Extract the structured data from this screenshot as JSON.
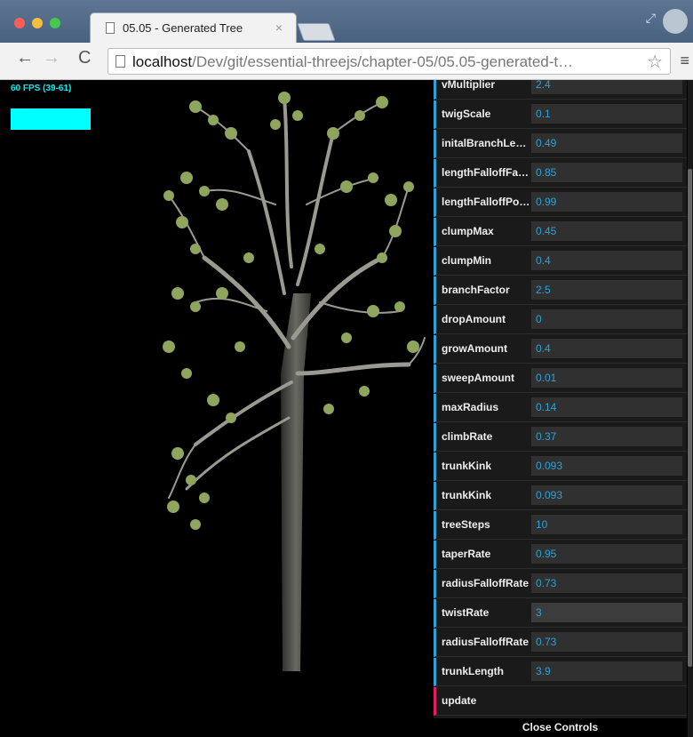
{
  "browser": {
    "tab_title": "05.05 - Generated Tree",
    "tab_close": "×",
    "url_host": "localhost",
    "url_path": "/Dev/git/essential-threejs/chapter-05/05.05-generated-t…",
    "back": "←",
    "forward": "→",
    "reload": "C",
    "star": "☆",
    "menu": "≡",
    "expand": "⤢"
  },
  "stats": {
    "fps_label": "60 FPS (39-61)"
  },
  "colors": {
    "accent": "#2fa1d6",
    "update_accent": "#e61d5f",
    "panel": "#1a1a1a"
  },
  "gui": {
    "rows": [
      {
        "label": "vMultiplier",
        "value": "2.4"
      },
      {
        "label": "twigScale",
        "value": "0.1"
      },
      {
        "label": "initalBranchLe…",
        "value": "0.49"
      },
      {
        "label": "lengthFalloffFa…",
        "value": "0.85"
      },
      {
        "label": "lengthFalloffPo…",
        "value": "0.99"
      },
      {
        "label": "clumpMax",
        "value": "0.45"
      },
      {
        "label": "clumpMin",
        "value": "0.4"
      },
      {
        "label": "branchFactor",
        "value": "2.5"
      },
      {
        "label": "dropAmount",
        "value": "0"
      },
      {
        "label": "growAmount",
        "value": "0.4"
      },
      {
        "label": "sweepAmount",
        "value": "0.01"
      },
      {
        "label": "maxRadius",
        "value": "0.14"
      },
      {
        "label": "climbRate",
        "value": "0.37"
      },
      {
        "label": "trunkKink",
        "value": "0.093"
      },
      {
        "label": "trunkKink",
        "value": "0.093"
      },
      {
        "label": "treeSteps",
        "value": "10"
      },
      {
        "label": "taperRate",
        "value": "0.95"
      },
      {
        "label": "radiusFalloffRate",
        "value": "0.73"
      },
      {
        "label": "twistRate",
        "value": "3"
      },
      {
        "label": "radiusFalloffRate",
        "value": "0.73"
      },
      {
        "label": "trunkLength",
        "value": "3.9"
      }
    ],
    "update_label": "update",
    "close_label": "Close Controls"
  }
}
